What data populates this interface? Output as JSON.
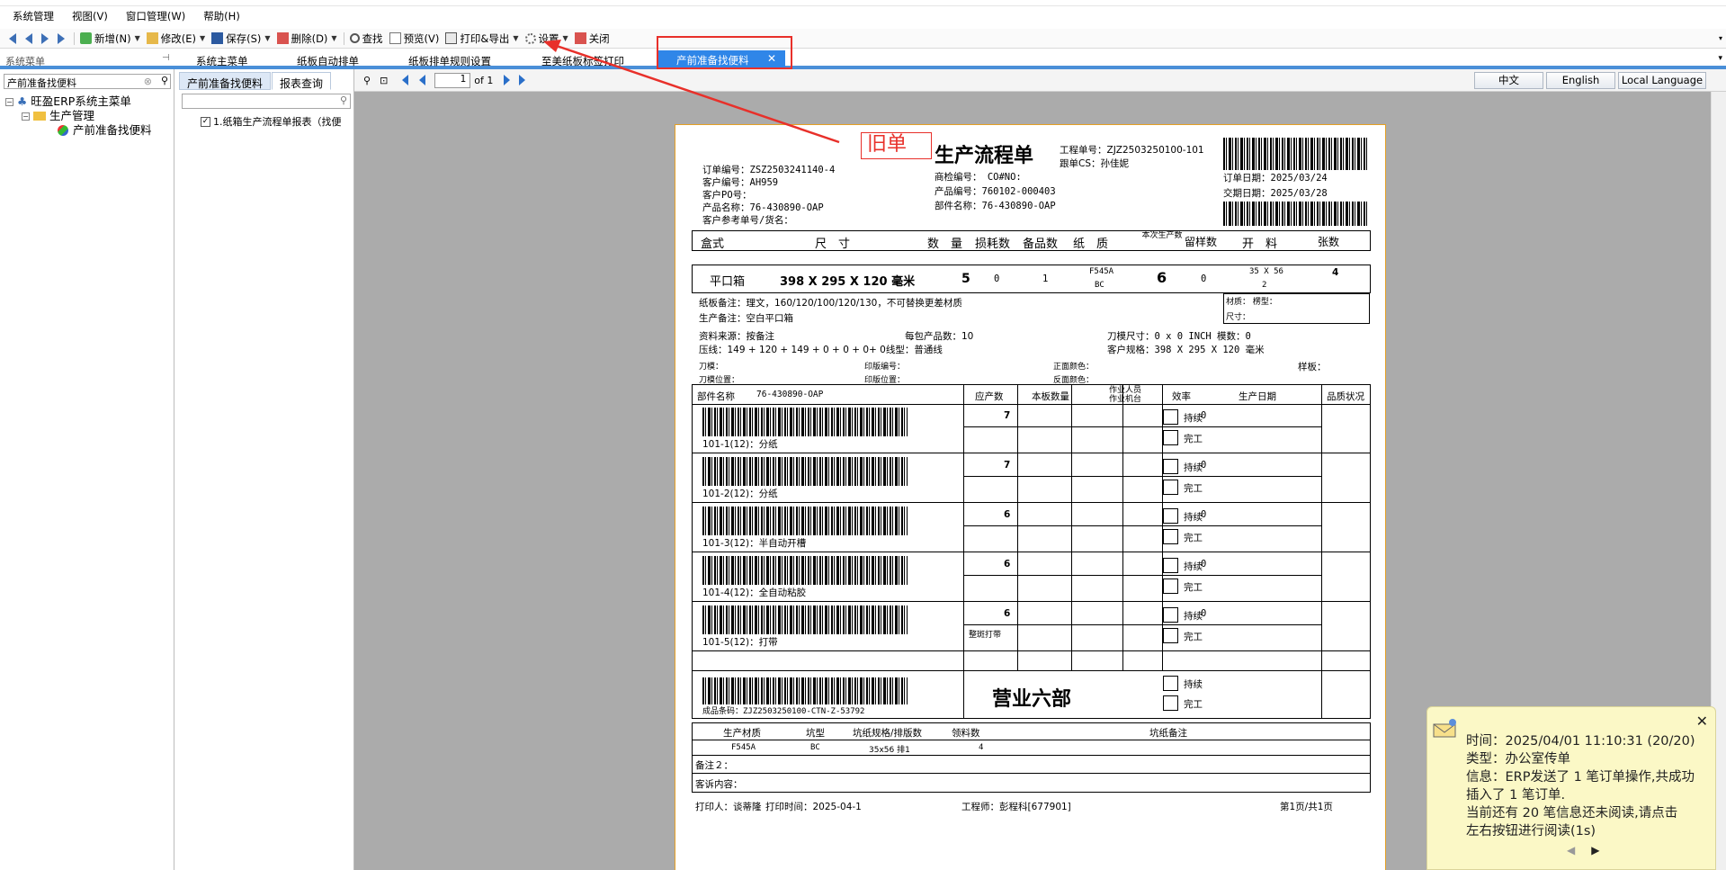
{
  "menu": [
    "系统管理",
    "视图(V)",
    "窗口管理(W)",
    "帮助(H)"
  ],
  "toolbar": {
    "new": "新增(N)",
    "edit": "修改(E)",
    "save": "保存(S)",
    "delete": "删除(D)",
    "find": "查找",
    "preview": "预览(V)",
    "print_export": "打印&导出",
    "settings": "设置",
    "close": "关闭"
  },
  "tabs": {
    "sys_label": "系统菜单",
    "items": [
      "系统主菜单",
      "纸板自动排单",
      "纸板排单规则设置",
      "至美纸板标签打印"
    ],
    "active": "产前准备找便料"
  },
  "sidebar": {
    "search_value": "产前准备找便料",
    "root": "旺盈ERP系统主菜单",
    "group": "生产管理",
    "leaf": "产前准备找便料"
  },
  "center": {
    "tab1": "产前准备找便料",
    "tab2": "报表查询",
    "item": "1.纸箱生产流程单报表（找便"
  },
  "viewer": {
    "page": "1",
    "of": "of 1",
    "lang": [
      "中文",
      "English",
      "Local Language"
    ]
  },
  "paper": {
    "title": "生产流程单",
    "stamp_old": "旧单",
    "proj_no": "工程单号：ZJZ2503250100-101",
    "follow": "跟单CS：孙佳妮",
    "order_no": "订单编号：ZSZ2503241140-4",
    "cust_no": "客户编号：AH959",
    "cust_po": "客户PO号：",
    "prod_name": "产品名称：76-430890-OAP",
    "cust_ref": "客户参考单号/货名：",
    "inspect_no": "商检编号： CO#NO:",
    "prod_no": "产品编号：760102-000403",
    "part_name": "部件名称：76-430890-OAP",
    "order_date": "订单日期：2025/03/24",
    "deliv_date": "交期日期：2025/03/28",
    "hdr": [
      "盒式",
      "尺　寸",
      "数　量",
      "损耗数",
      "备品数",
      "纸　质",
      "本次生产数",
      "留样数",
      "开　料",
      "张数"
    ],
    "box_type": "平口箱",
    "size": "398 X 295 X 120 毫米",
    "qty": "5",
    "loss": "0",
    "spare": "1",
    "paper_q1": "F545A",
    "paper_q2": "BC",
    "this_prod": "6",
    "sample": "0",
    "cut1": "35 X 56",
    "cut2": "2",
    "sheets": "4",
    "note_board": "纸板备注：理文，160/120/100/120/130，不可替换更差材质",
    "note_prod": "生产备注：空白平口箱",
    "material": "材质： 楞型：",
    "size_box": "尺寸：",
    "src": "资料来源：按备注",
    "per_pack": "每包产品数：10",
    "die_size": "刀模尺寸：0 x 0 INCH 模数：0",
    "press": "压线：149 + 120 + 149 + 0 + 0 + 0+ 0线型：普通线",
    "cust_spec": "客户规格：398 X 295 X 120 毫米",
    "die": "刀模：",
    "print_no": "印版编号：",
    "front_color": "正面颜色：",
    "sample_board": "样板：",
    "die_pos": "刀模位置：",
    "print_pos": "印版位置：",
    "back_color": "反面颜色：",
    "proc_hdr": [
      "部件名称",
      "76-430890-OAP",
      "应产数",
      "本板数量",
      "作业人员作业机台",
      "效率",
      "生产日期",
      "品质状况"
    ],
    "processes": [
      {
        "label": "101-1(12)：分纸",
        "qty": "7",
        "eff": "0"
      },
      {
        "label": "101-2(12)：分纸",
        "qty": "7",
        "eff": "0"
      },
      {
        "label": "101-3(12)：半自动开槽",
        "qty": "6",
        "eff": "0"
      },
      {
        "label": "101-4(12)：全自动粘胶",
        "qty": "6",
        "eff": "0"
      },
      {
        "label": "101-5(12)：打带",
        "qty": "6",
        "eff": "0"
      }
    ],
    "bundle_note": "整斑打带",
    "cont": "持续",
    "done": "完工",
    "finished_bc": "成品条码：ZJZ2503250100-CTN-Z-53792",
    "dept": "营业六部",
    "mat_hdr": [
      "生产材质",
      "坑型",
      "坑纸规格/排版数",
      "领料数",
      "坑纸备注"
    ],
    "mat_row": [
      "F545A",
      "BC",
      "35x56 排1",
      "4",
      ""
    ],
    "remark2": "备注２：",
    "complaint": "客诉内容：",
    "printer": "打印人：谈蒂隆",
    "print_time": "打印时间：2025-04-1",
    "engineer": "工程师：彭程科[677901]",
    "page_info": "第1页/共1页"
  },
  "notification": {
    "time": "时间：2025/04/01 11:10:31 (20/20)",
    "type": "类型：办公室传单",
    "info1": "信息：ERP发送了 1 笔订单操作,共成功",
    "info2": "插入了 1 笔订单.",
    "info3": "当前还有 20 笔信息还未阅读,请点击",
    "info4": "左右按钮进行阅读(1s)"
  },
  "colors": {
    "accent": "#2f86e8",
    "annotation": "#e8302a",
    "paper_border": "#e5a024",
    "notify_bg": "#fbf8c6"
  }
}
